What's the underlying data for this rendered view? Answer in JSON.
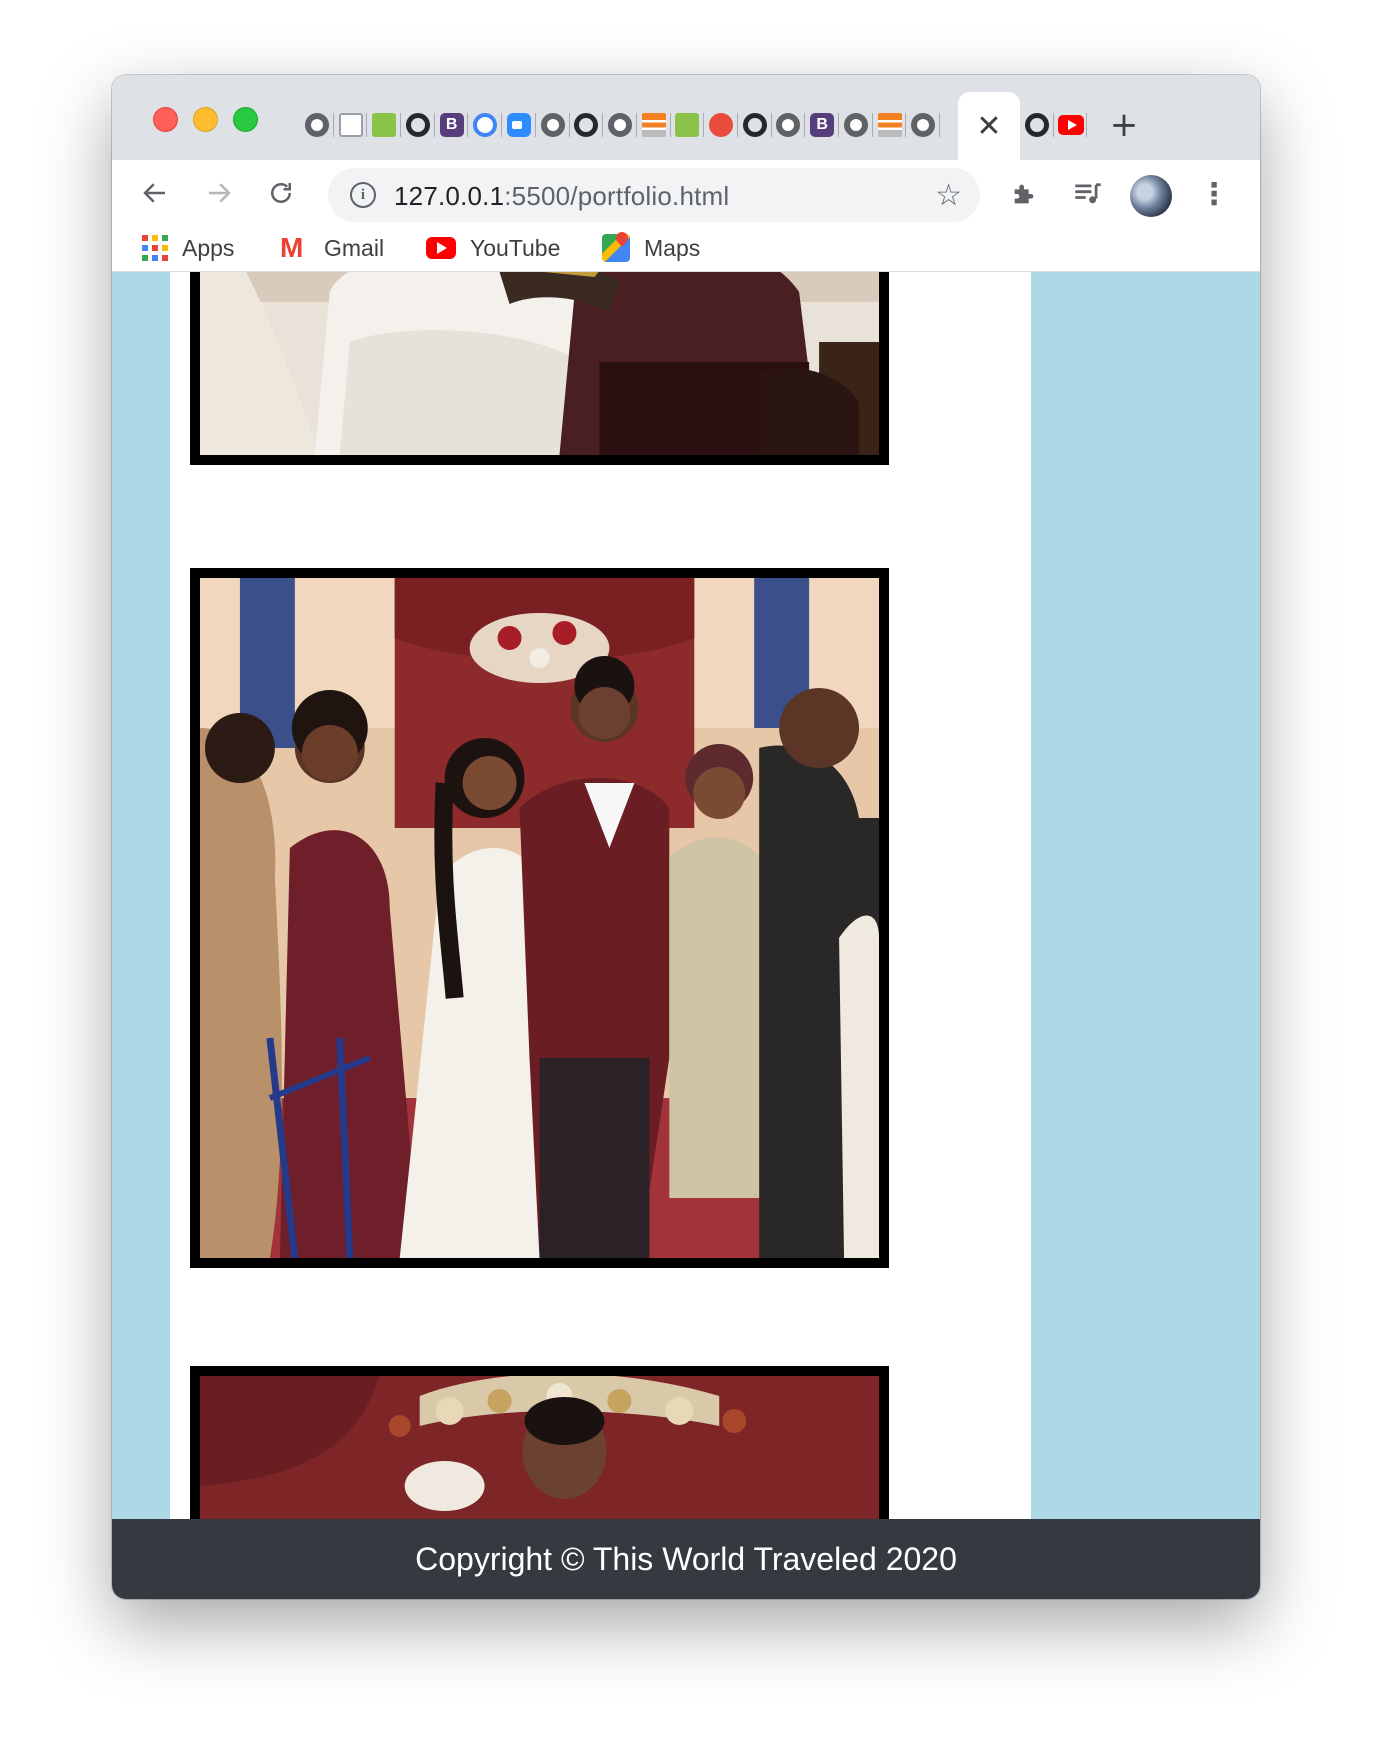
{
  "browser": {
    "favicons": [
      "globe",
      "doc",
      "green",
      "github",
      "boot",
      "sync",
      "zoom",
      "globe",
      "github",
      "globe",
      "stack",
      "green",
      "asterisk",
      "github",
      "globe",
      "boot",
      "globe",
      "stack",
      "globe"
    ],
    "tabs_after": [
      "github",
      "yt"
    ],
    "active_tab_close": "✕",
    "new_tab": "+",
    "url_host": "127.0.0.1",
    "url_rest": ":5500/portfolio.html",
    "bookmarks": [
      {
        "label": "Apps",
        "icon": "apps-grid-icon"
      },
      {
        "label": "Gmail",
        "icon": "gmail-icon"
      },
      {
        "label": "YouTube",
        "icon": "youtube-icon"
      },
      {
        "label": "Maps",
        "icon": "maps-icon"
      }
    ]
  },
  "page": {
    "background": "#add8e6",
    "column_background": "#ffffff",
    "photos": [
      {
        "subject": "bride and groom holding hands at altar"
      },
      {
        "subject": "bride and groom walking down aisle with guests"
      },
      {
        "subject": "bride and groom portrait with floral arch"
      }
    ]
  },
  "footer": {
    "text": "Copyright © This World Traveled 2020",
    "background": "#343a40"
  }
}
